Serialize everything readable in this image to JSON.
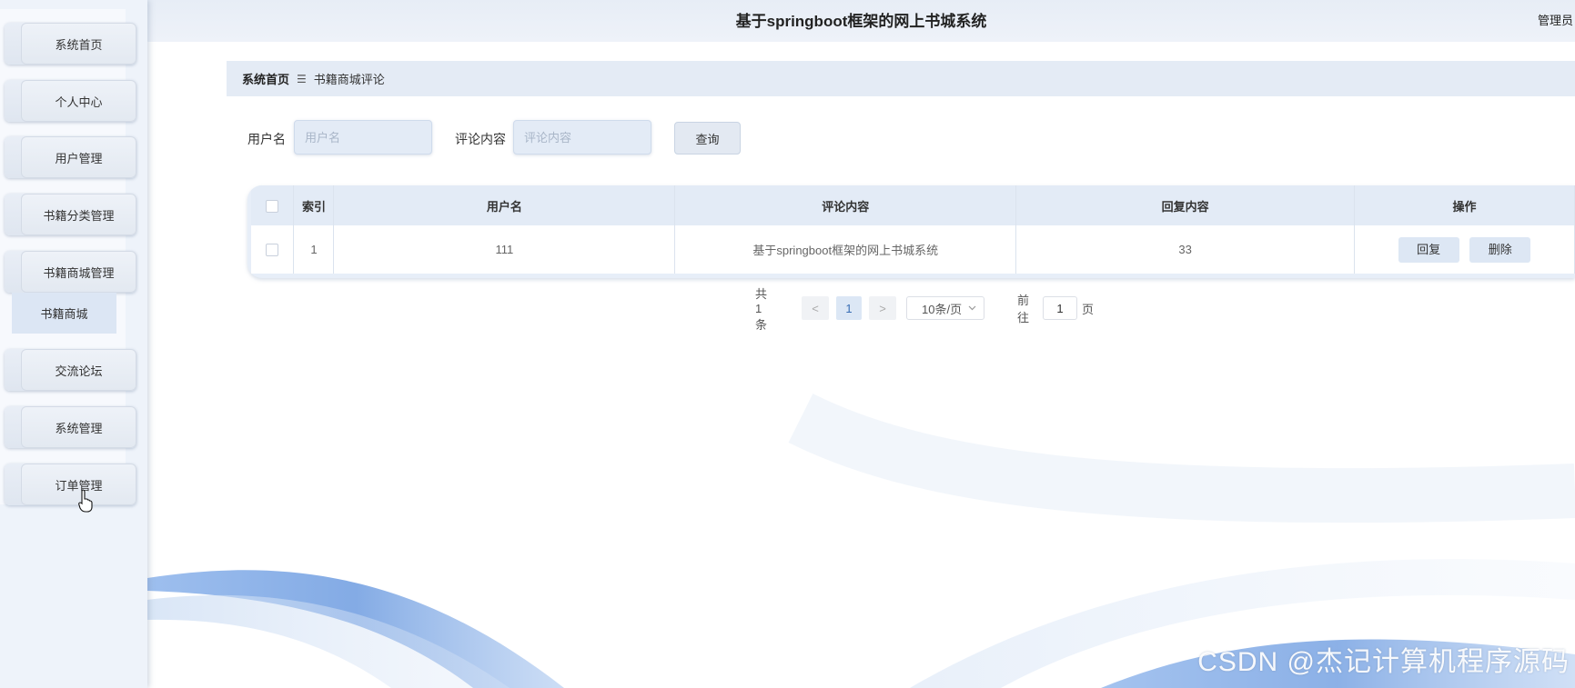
{
  "app": {
    "title": "基于springboot框架的网上书城系统",
    "user_role": "管理员"
  },
  "sidebar": {
    "items": [
      {
        "label": "系统首页"
      },
      {
        "label": "个人中心"
      },
      {
        "label": "用户管理"
      },
      {
        "label": "书籍分类管理"
      },
      {
        "label": "书籍商城管理"
      },
      {
        "label": "交流论坛"
      },
      {
        "label": "系统管理"
      },
      {
        "label": "订单管理"
      }
    ],
    "submenu": {
      "label": "书籍商城"
    }
  },
  "breadcrumb": {
    "home": "系统首页",
    "separator": "☰",
    "current": "书籍商城评论"
  },
  "search": {
    "username_label": "用户名",
    "username_placeholder": "用户名",
    "content_label": "评论内容",
    "content_placeholder": "评论内容",
    "query_button": "查询"
  },
  "table": {
    "headers": [
      "索引",
      "用户名",
      "评论内容",
      "回复内容",
      "操作"
    ],
    "rows": [
      {
        "index": "1",
        "username": "111",
        "content": "基于springboot框架的网上书城系统",
        "reply": "33"
      }
    ],
    "actions": {
      "reply": "回复",
      "delete": "删除"
    }
  },
  "pagination": {
    "total": "共 1 条",
    "prev": "<",
    "current_page": "1",
    "next": ">",
    "page_size": "10条/页",
    "goto_label": "前往",
    "goto_value": "1",
    "page_suffix": "页"
  },
  "watermark": "CSDN @杰记计算机程序源码",
  "colors": {
    "sidebar_bg": "#eef3fa",
    "header_bg": "#e7edf6",
    "accent": "#3a6fb5",
    "wave": "#4a86d8"
  },
  "icons": [
    "checkbox-icon",
    "chevron-down-icon",
    "hand-cursor-icon"
  ]
}
